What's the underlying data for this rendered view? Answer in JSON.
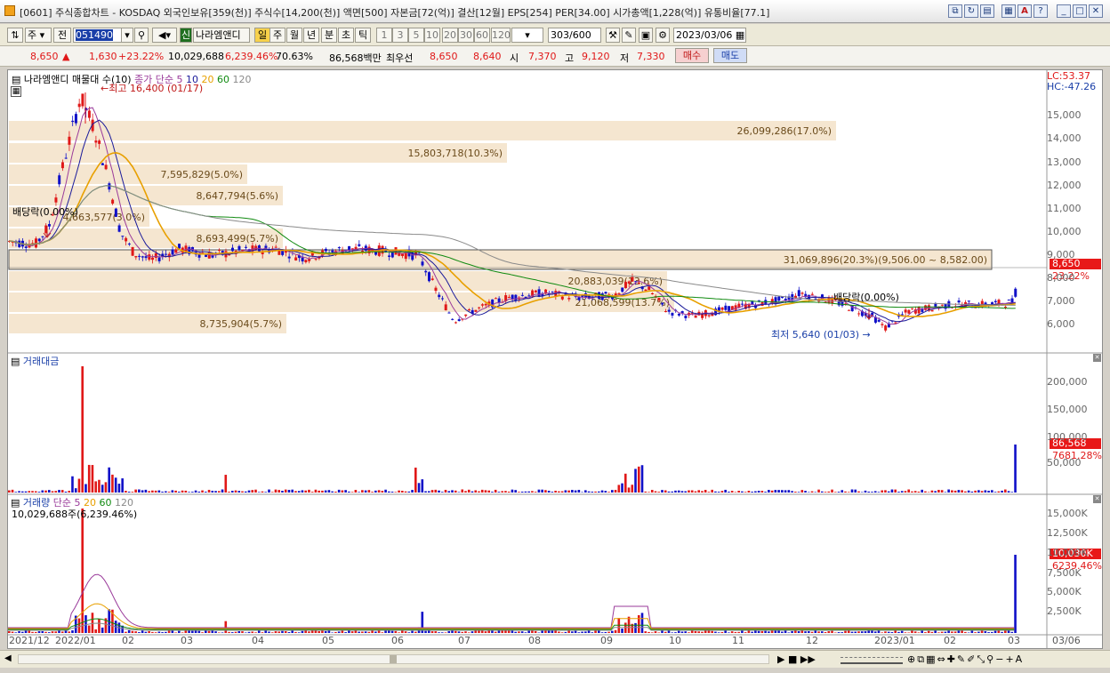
{
  "window": {
    "title": "[0601] 주식종합차트 - KOSDAQ 외국인보유[359(천)] 주식수[14,200(천)] 액면[500] 자본금[72(억)] 결산[12월] EPS[254] PER[34.00] 시가총액[1,228(억)] 유통비율[77.1]"
  },
  "toolbar": {
    "type_select": "주",
    "prev_label": "전",
    "code_value": "051490",
    "stock_badge": "신",
    "stock_name": "나라엠앤디",
    "period_buttons": [
      "일",
      "주",
      "월",
      "년",
      "분",
      "초",
      "틱"
    ],
    "interval_buttons": [
      "1",
      "3",
      "5",
      "10",
      "20",
      "30",
      "60",
      "120"
    ],
    "count_value": "303",
    "count_total": "/600",
    "date_value": "2023/03/06"
  },
  "quote": {
    "price": "8,650",
    "change": "1,630",
    "change_pct": "+23.22%",
    "volume": "10,029,688",
    "volume_pct": "6,239.46%",
    "ratio": "70.63%",
    "amount": "86,568백만",
    "best_label": "최우선",
    "ask": "8,650",
    "bid": "8,640",
    "open_label": "시",
    "open": "7,370",
    "high_label": "고",
    "high": "9,120",
    "low_label": "저",
    "low": "7,330",
    "buy_label": "매수",
    "sell_label": "매도"
  },
  "price_panel": {
    "legend_name": "나라엠앤디 매물대 수(10)",
    "legend_ma": "종가 단순",
    "ma_periods": [
      "5",
      "10",
      "20",
      "60",
      "120"
    ],
    "lc": "LC:53.37",
    "hc": "HC:-47.26",
    "y_ticks": [
      "15,000",
      "14,000",
      "13,000",
      "12,000",
      "11,000",
      "10,000",
      "9,000",
      "8,000",
      "7,000",
      "6,000"
    ],
    "high_note": "최고 16,400 (01/17)",
    "low_note": "최저 5,640 (01/03)",
    "div_left": "배당락(0.00%)",
    "div_right": "배당락(0.00%)",
    "current_price": "8,650",
    "current_pct": "23.22%",
    "volume_profile": [
      {
        "label": "26,099,286(17.0%)"
      },
      {
        "label": "15,803,718(10.3%)"
      },
      {
        "label": "7,595,829(5.0%)"
      },
      {
        "label": "8,647,794(5.6%)"
      },
      {
        "label": "4,663,577(3.0%)"
      },
      {
        "label": "8,693,499(5.7%)"
      },
      {
        "label": "31,069,896(20.3%)(9,506.00 ~ 8,582.00)"
      },
      {
        "label": "20,883,039(13.6%)"
      },
      {
        "label": "21,068,599(13.7%)"
      },
      {
        "label": "8,735,904(5.7%)"
      }
    ]
  },
  "amount_panel": {
    "title": "거래대금",
    "y_ticks": [
      "200,000",
      "150,000",
      "100,000",
      "50,000"
    ],
    "current_value": "86,568",
    "current_pct": "7681.28%"
  },
  "volume_panel": {
    "title": "거래량",
    "legend_ma": "단순",
    "ma_periods": [
      "5",
      "20",
      "60",
      "120"
    ],
    "subtitle": "10,029,688주(6,239.46%)",
    "y_ticks": [
      "15,000K",
      "12,500K",
      "10,000K",
      "7,500K",
      "5,000K",
      "2,500K"
    ],
    "current_value": "10,030K",
    "current_pct": "6239.46%"
  },
  "x_axis": [
    "2021/12",
    "2022/01",
    "02",
    "03",
    "04",
    "05",
    "06",
    "07",
    "08",
    "09",
    "10",
    "11",
    "12",
    "2023/01",
    "02",
    "03",
    "03/06"
  ],
  "colors": {
    "up": "#e01818",
    "down": "#1010c8",
    "ma5": "#9a3a9a",
    "ma10": "#1a1a9a",
    "ma20": "#e8a000",
    "ma60": "#108a10",
    "ma120": "#8a8a8a",
    "profile": "#f5e6d0"
  }
}
